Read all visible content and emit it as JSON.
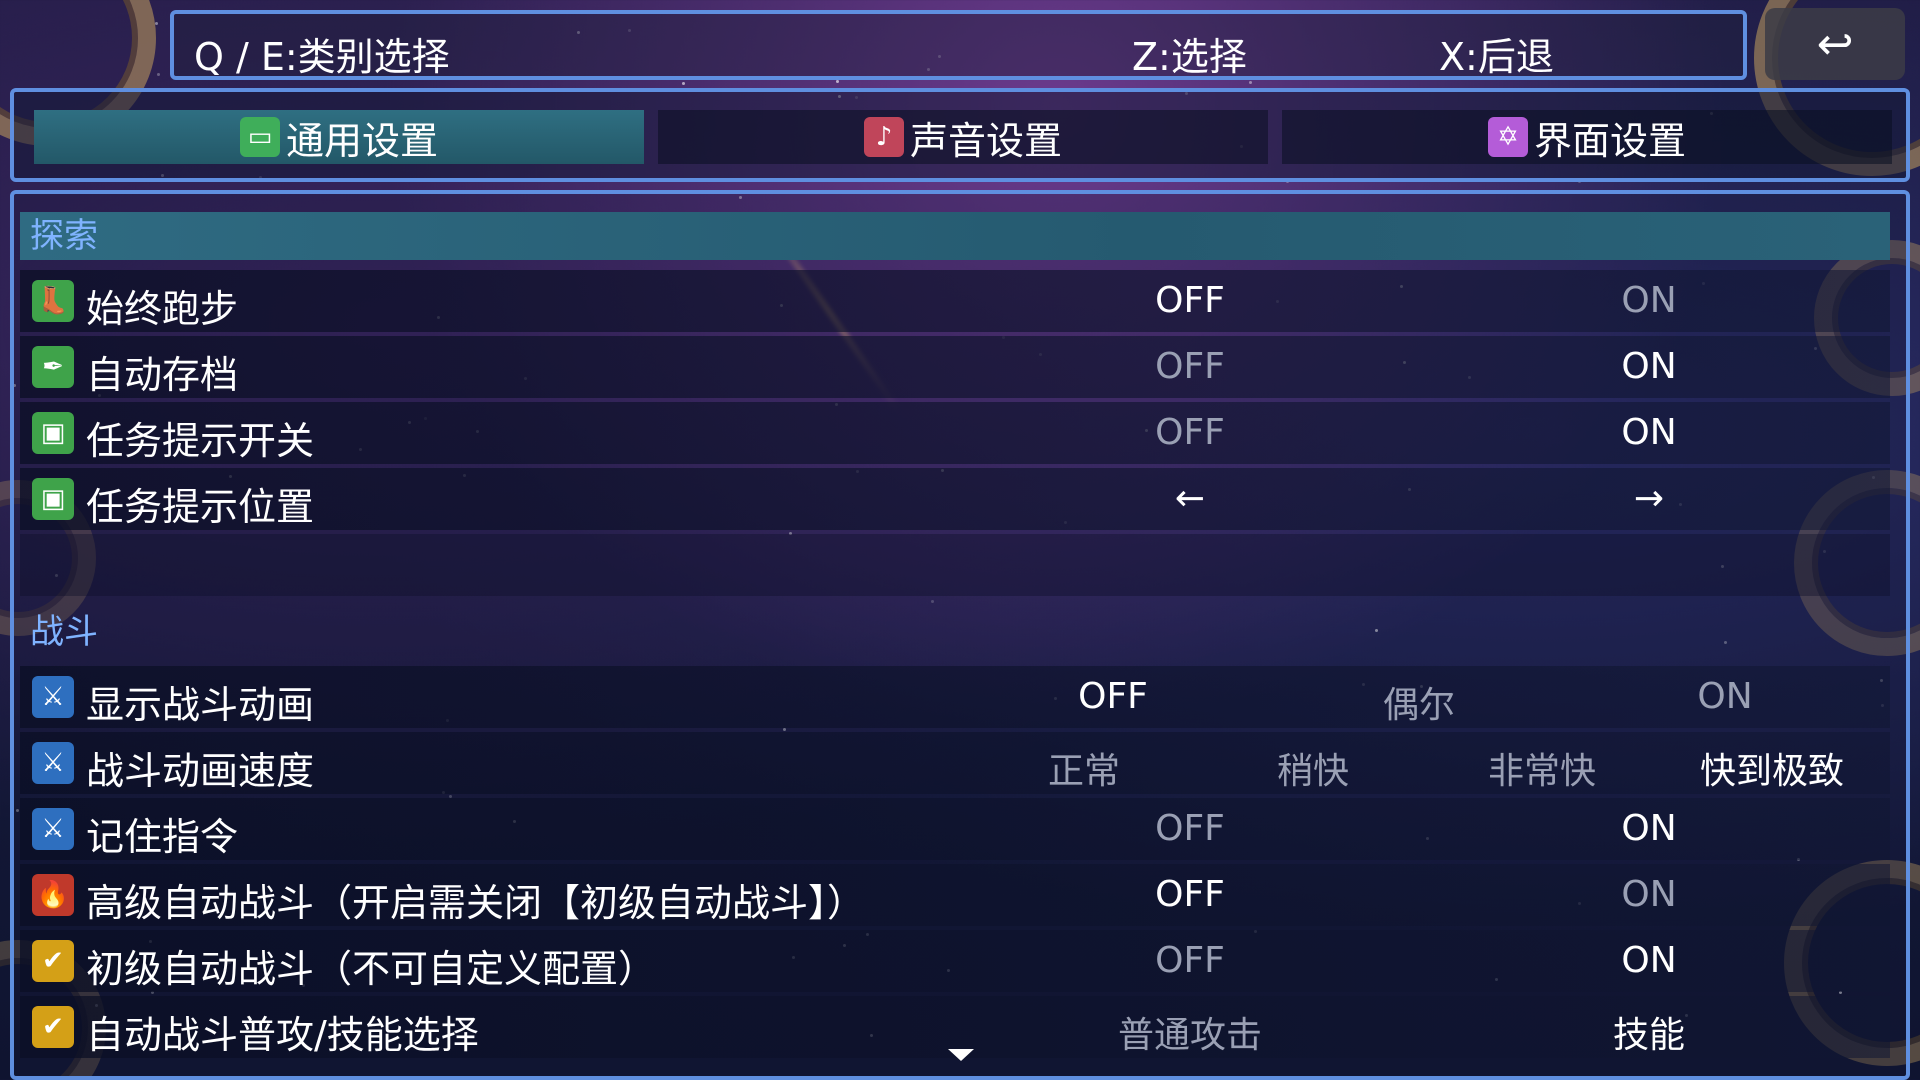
{
  "help": {
    "category": "Q / E:类别选择",
    "select": "Z:选择",
    "back": "X:后退"
  },
  "back_icon": "↩",
  "tabs": [
    {
      "label": "通用设置",
      "icon": "window-icon",
      "glyph": "▭",
      "color": "#3fae5a",
      "active": true
    },
    {
      "label": "声音设置",
      "icon": "music-note-icon",
      "glyph": "♪",
      "color": "#c0455a",
      "active": false
    },
    {
      "label": "界面设置",
      "icon": "hexagram-icon",
      "glyph": "✡",
      "color": "#b45cd8",
      "active": false
    }
  ],
  "sections": {
    "explore": "探索",
    "battle": "战斗"
  },
  "rows": [
    {
      "label": "始终跑步",
      "icon": "boot-icon",
      "glyph": "👢",
      "icon_color": "#3fa34a",
      "options": [
        {
          "text": "OFF",
          "selected": true
        },
        {
          "text": "ON",
          "selected": false
        }
      ]
    },
    {
      "label": "自动存档",
      "icon": "quill-icon",
      "glyph": "✒",
      "icon_color": "#3fa34a",
      "options": [
        {
          "text": "OFF",
          "selected": false
        },
        {
          "text": "ON",
          "selected": true
        }
      ]
    },
    {
      "label": "任务提示开关",
      "icon": "window-icon",
      "glyph": "▣",
      "icon_color": "#3fa34a",
      "options": [
        {
          "text": "OFF",
          "selected": false
        },
        {
          "text": "ON",
          "selected": true
        }
      ]
    },
    {
      "label": "任务提示位置",
      "icon": "window-icon",
      "glyph": "▣",
      "icon_color": "#3fa34a",
      "options": [
        {
          "text": "←",
          "selected": true
        },
        {
          "text": "→",
          "selected": true
        }
      ]
    },
    {
      "label": "显示战斗动画",
      "icon": "sword-icon",
      "glyph": "⚔",
      "icon_color": "#2e6fbf",
      "options": [
        {
          "text": "OFF",
          "selected": true
        },
        {
          "text": "偶尔",
          "selected": false
        },
        {
          "text": "ON",
          "selected": false
        }
      ]
    },
    {
      "label": "战斗动画速度",
      "icon": "sword-icon",
      "glyph": "⚔",
      "icon_color": "#2e6fbf",
      "options": [
        {
          "text": "正常",
          "selected": false
        },
        {
          "text": "稍快",
          "selected": false
        },
        {
          "text": "非常快",
          "selected": false
        },
        {
          "text": "快到极致",
          "selected": true
        }
      ]
    },
    {
      "label": "记住指令",
      "icon": "sword-icon",
      "glyph": "⚔",
      "icon_color": "#2e6fbf",
      "options": [
        {
          "text": "OFF",
          "selected": false
        },
        {
          "text": "ON",
          "selected": true
        }
      ]
    },
    {
      "label": "高级自动战斗（开启需关闭【初级自动战斗】）",
      "icon": "flame-sword-icon",
      "glyph": "🔥",
      "icon_color": "#c0392b",
      "options": [
        {
          "text": "OFF",
          "selected": true
        },
        {
          "text": "ON",
          "selected": false
        }
      ]
    },
    {
      "label": "初级自动战斗（不可自定义配置）",
      "icon": "checkmark-icon",
      "glyph": "✔",
      "icon_color": "#d4a017",
      "options": [
        {
          "text": "OFF",
          "selected": false
        },
        {
          "text": "ON",
          "selected": true
        }
      ]
    },
    {
      "label": "自动战斗普攻/技能选择",
      "icon": "checkmark-icon",
      "glyph": "✔",
      "icon_color": "#d4a017",
      "options": [
        {
          "text": "普通攻击",
          "selected": false
        },
        {
          "text": "技能",
          "selected": true
        }
      ]
    }
  ]
}
